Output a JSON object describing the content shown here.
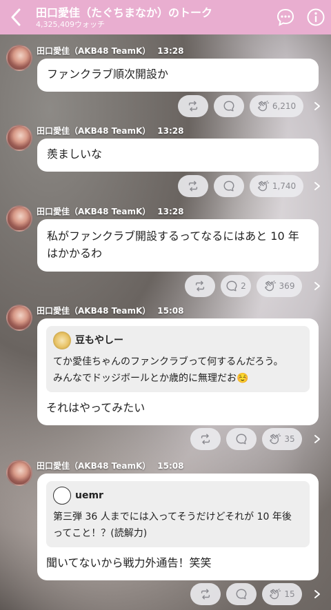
{
  "header": {
    "title": "田口愛佳（たぐちまなか）のトーク",
    "subtitle": "4,325,409ウォッチ"
  },
  "messages": [
    {
      "author": "田口愛佳（AKB48 TeamK）",
      "time": "13:28",
      "text": "ファンクラブ順次開設か",
      "reply_count": "",
      "clap_count": "6,210"
    },
    {
      "author": "田口愛佳（AKB48 TeamK）",
      "time": "13:28",
      "text": "羨ましいな",
      "reply_count": "",
      "clap_count": "1,740"
    },
    {
      "author": "田口愛佳（AKB48 TeamK）",
      "time": "13:28",
      "text_line1": "私がファンクラブ開設するってなるにはあと 10 年",
      "text_line2": "はかかるわ",
      "reply_count": "2",
      "clap_count": "369"
    },
    {
      "author": "田口愛佳（AKB48 TeamK）",
      "time": "15:08",
      "quote_name": "豆もやしー",
      "quote_line1": "てか愛佳ちゃんのファンクラブって何するんだろう。",
      "quote_line2": "みんなでドッジボールとか歳的に無理だお☺️",
      "text": "それはやってみたい",
      "reply_count": "",
      "clap_count": "35"
    },
    {
      "author": "田口愛佳（AKB48 TeamK）",
      "time": "15:08",
      "quote_name": "uemr",
      "quote_line1": "第三弾 36 人までには入ってそうだけどそれが 10 年後",
      "quote_line2": "ってこと！？(読解力)",
      "text": "聞いてないから戦力外通告！笑笑",
      "reply_count": "",
      "clap_count": "15"
    }
  ],
  "colors": {
    "header": "#e9aed0",
    "bubble": "#ffffff",
    "action_bg": "#ebebee"
  }
}
